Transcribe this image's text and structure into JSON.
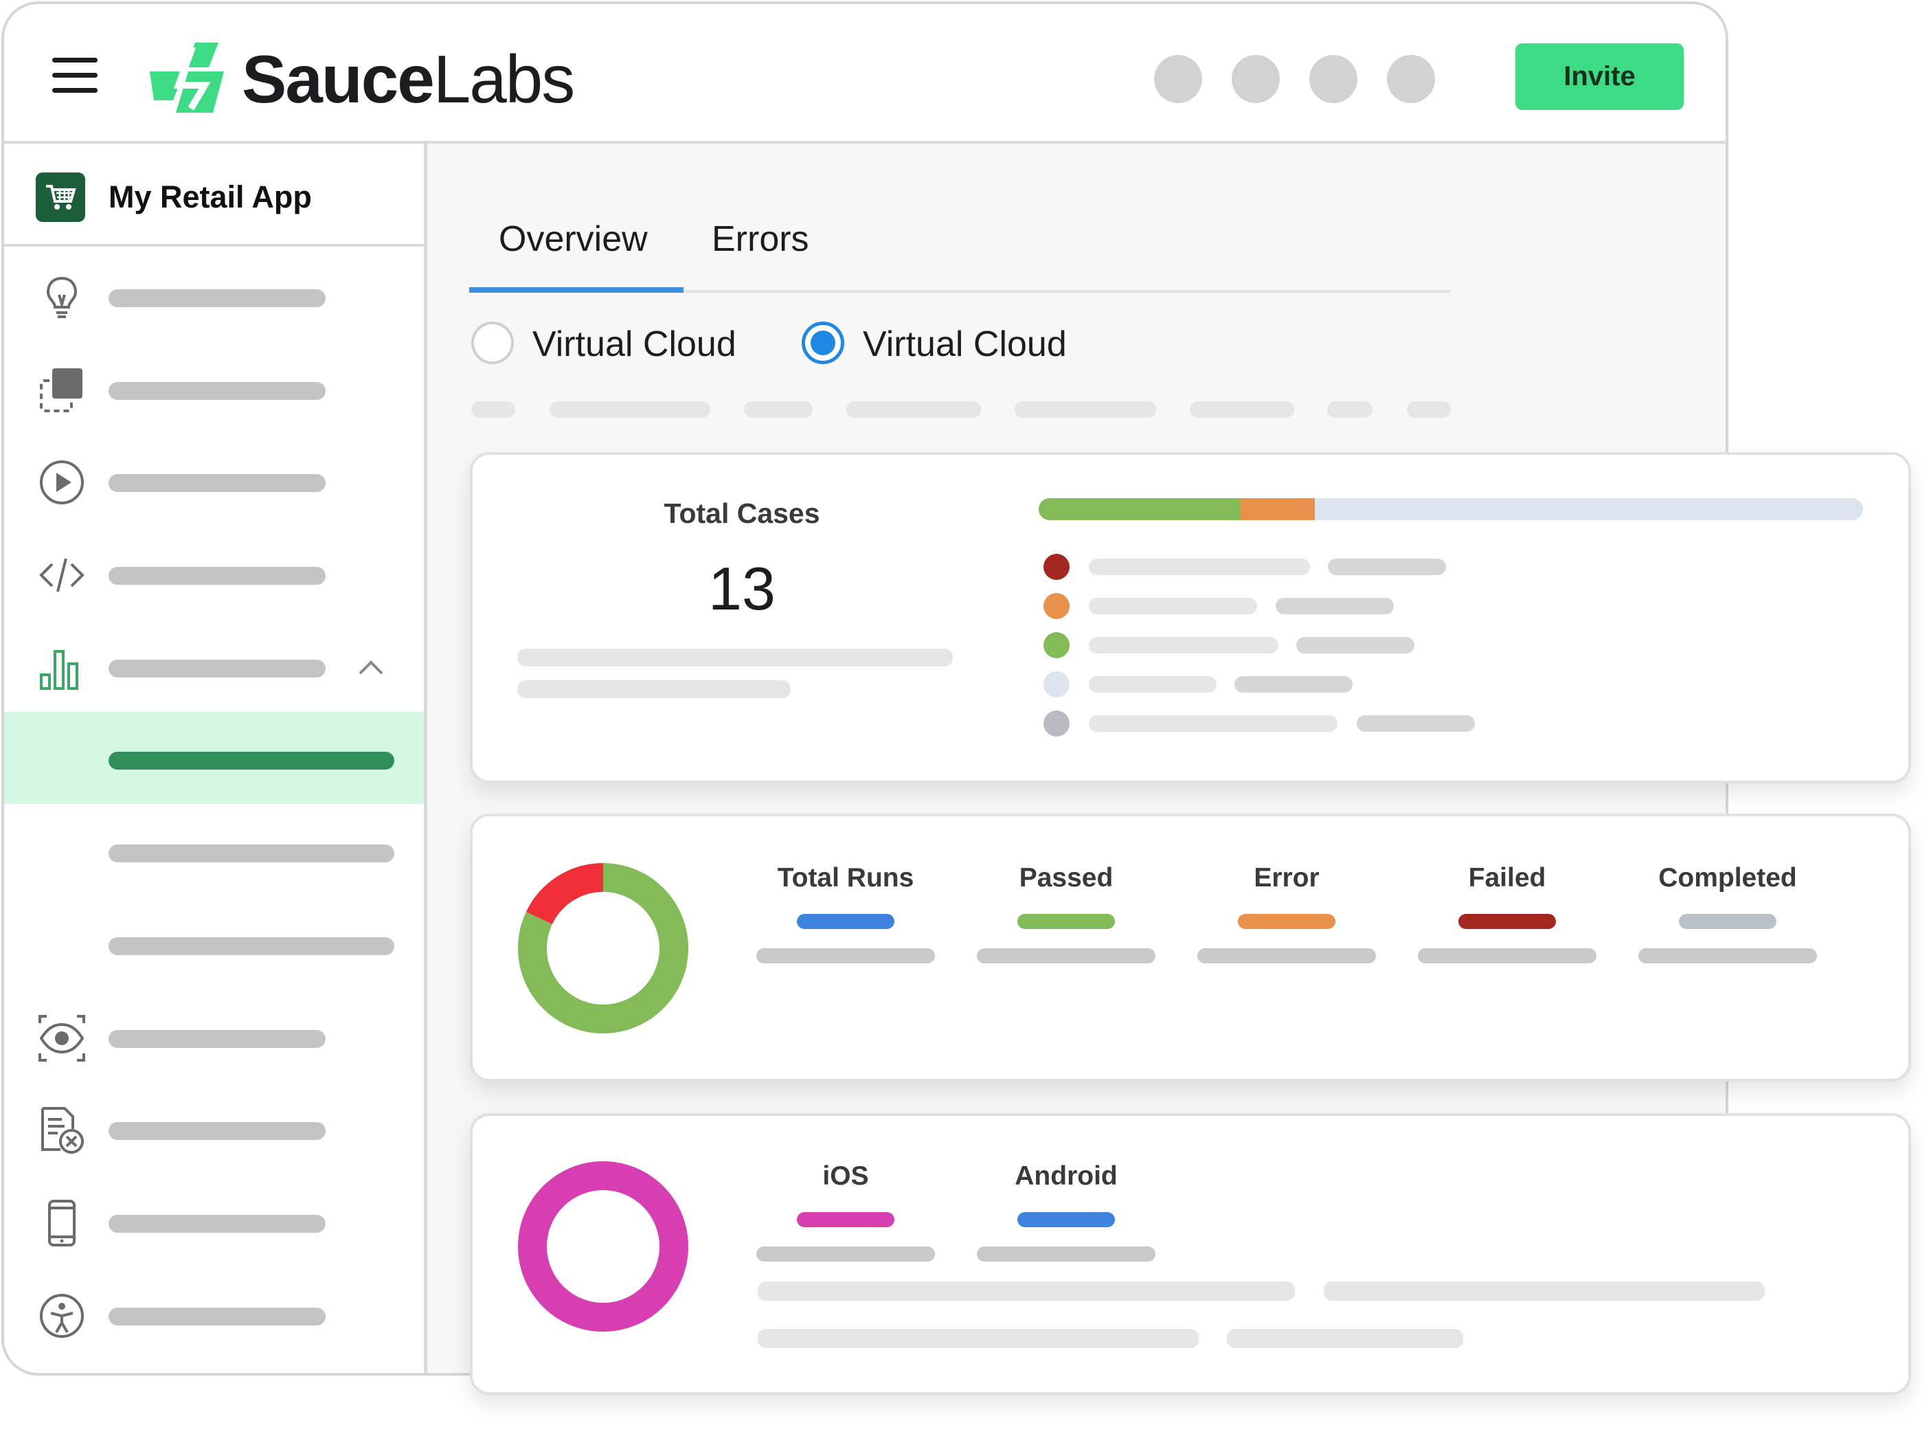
{
  "brand": {
    "name_bold": "Sauce",
    "name_light": "Labs",
    "accent": "#3ddc84"
  },
  "header": {
    "invite_label": "Invite",
    "avatar_count": 4
  },
  "sidebar": {
    "app_name": "My Retail App",
    "app_icon": "shopping-cart-icon",
    "items": [
      {
        "icon": "lightbulb-icon"
      },
      {
        "icon": "layers-icon"
      },
      {
        "icon": "play-circle-icon"
      },
      {
        "icon": "code-icon"
      },
      {
        "icon": "bar-chart-icon",
        "expanded": true,
        "children": [
          {
            "active": true
          },
          {
            "active": false
          },
          {
            "active": false
          }
        ]
      },
      {
        "icon": "eye-icon"
      },
      {
        "icon": "document-error-icon"
      },
      {
        "icon": "mobile-device-icon"
      },
      {
        "icon": "accessibility-icon"
      }
    ]
  },
  "tabs": [
    {
      "label": "Overview",
      "active": true
    },
    {
      "label": "Errors",
      "active": false
    }
  ],
  "filters": [
    {
      "label": "Virtual Cloud",
      "checked": false
    },
    {
      "label": "Virtual Cloud",
      "checked": true
    }
  ],
  "total_cases_card": {
    "title": "Total Cases",
    "value": "13",
    "progress_segments": [
      {
        "color": "#84bb59",
        "fraction": 0.245
      },
      {
        "color": "#e8914a",
        "fraction": 0.09
      },
      {
        "color": "#dce4ee",
        "fraction": 0.665
      }
    ],
    "legend_colors": [
      "#a32620",
      "#e8914a",
      "#84bb59",
      "#dce4ee",
      "#b8bcc2"
    ]
  },
  "runs_card": {
    "donut_segments": [
      {
        "color": "#84bb59",
        "fraction": 0.82
      },
      {
        "color": "#ef2e36",
        "fraction": 0.18
      }
    ],
    "stats": [
      {
        "label": "Total Runs",
        "color": "#3f82de"
      },
      {
        "label": "Passed",
        "color": "#84bb59"
      },
      {
        "label": "Error",
        "color": "#e8914a"
      },
      {
        "label": "Failed",
        "color": "#a32620"
      },
      {
        "label": "Completed",
        "color": "#b8c0c8"
      }
    ]
  },
  "platform_card": {
    "donut_color": "#d63eb1",
    "stats": [
      {
        "label": "iOS",
        "color": "#d63eb1"
      },
      {
        "label": "Android",
        "color": "#3f82de"
      }
    ]
  }
}
